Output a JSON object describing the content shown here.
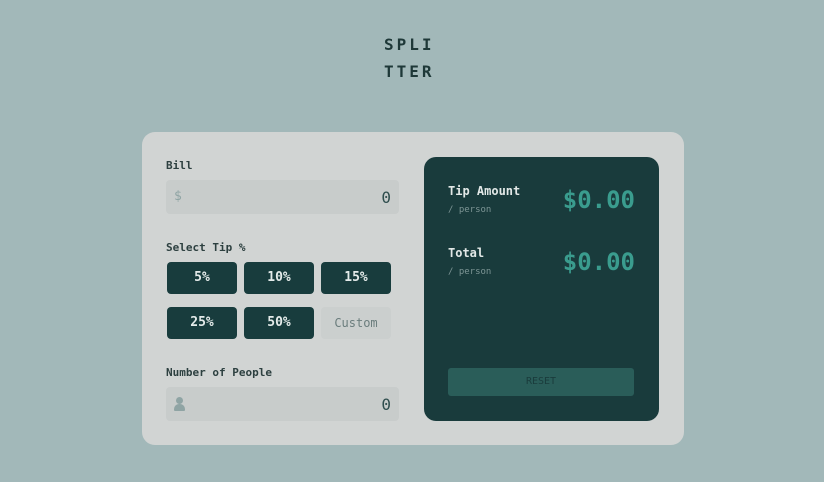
{
  "logo": {
    "line1": "SPLI",
    "line2": "TTER"
  },
  "bill": {
    "label": "Bill",
    "icon": "dollar-icon",
    "icon_glyph": "$",
    "value": "0"
  },
  "tip": {
    "label": "Select Tip %",
    "options": [
      "5%",
      "10%",
      "15%",
      "25%",
      "50%"
    ],
    "custom_label": "Custom"
  },
  "people": {
    "label": "Number of People",
    "icon": "person-icon",
    "value": "0"
  },
  "results": {
    "tip_amount": {
      "title": "Tip Amount",
      "sub": "/ person",
      "value": "$0.00"
    },
    "total": {
      "title": "Total",
      "sub": "/ person",
      "value": "$0.00"
    },
    "reset_label": "RESET"
  },
  "colors": {
    "background": "#a2b8b9",
    "card": "#d1d4d3",
    "dark": "#193b3c",
    "accent": "#3a9c8e"
  }
}
